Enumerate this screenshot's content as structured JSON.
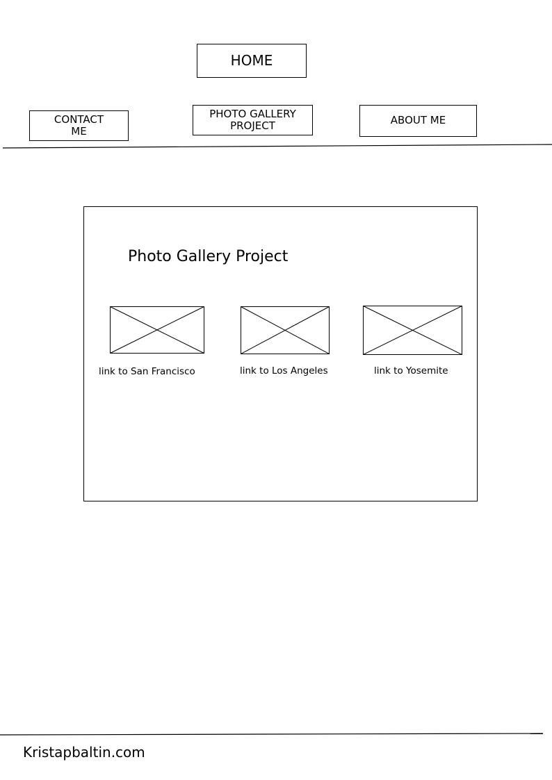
{
  "nav": {
    "home_label": "HOME",
    "contact_label": "CONTACT\nME",
    "gallery_label": "PHOTO GALLERY\nPROJECT",
    "about_label": "ABOUT ME"
  },
  "main": {
    "title": "Photo Gallery Project",
    "gallery": [
      {
        "image": "image-placeholder-icon",
        "link_label": "link to San Francisco"
      },
      {
        "image": "image-placeholder-icon",
        "link_label": "link to Los Angeles"
      },
      {
        "image": "image-placeholder-icon",
        "link_label": "link to Yosemite"
      }
    ]
  },
  "footer": {
    "domain": "Kristapbaltin.com"
  },
  "colors": {
    "stroke": "#000000",
    "background": "#ffffff"
  }
}
